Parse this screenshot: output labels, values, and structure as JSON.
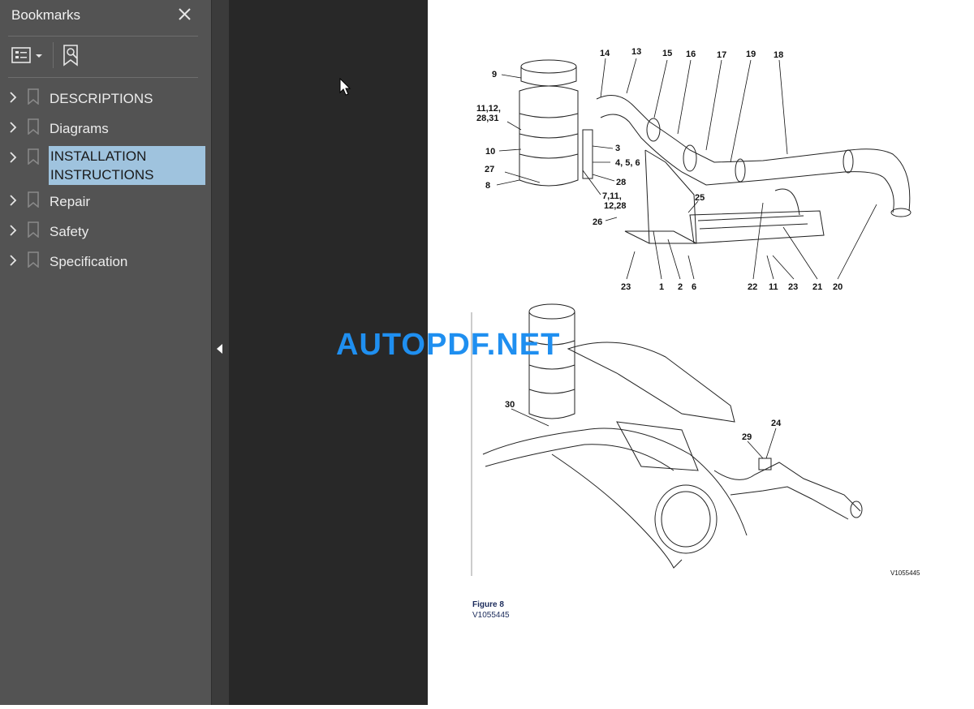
{
  "panel": {
    "title": "Bookmarks",
    "items": [
      {
        "label": "DESCRIPTIONS"
      },
      {
        "label": "Diagrams"
      },
      {
        "label": "INSTALLATION\nINSTRUCTIONS",
        "selected": true
      },
      {
        "label": "Repair"
      },
      {
        "label": "Safety"
      },
      {
        "label": "Specification"
      }
    ]
  },
  "watermark": "AUTOPDF.NET",
  "figure": {
    "caption_title": "Figure 8",
    "caption_id": "V1055445",
    "corner_id": "V1055445",
    "callouts_top": [
      "14",
      "13",
      "15",
      "16",
      "17",
      "19",
      "18",
      "9",
      "11,12,",
      "28,31",
      "10",
      "3",
      "4, 5, 6",
      "27",
      "8",
      "28",
      "7,11,",
      "12,28",
      "25",
      "26",
      "23",
      "1",
      "2",
      "6",
      "22",
      "11",
      "23",
      "21",
      "20"
    ],
    "callouts_bottom": [
      "30",
      "29",
      "24"
    ]
  },
  "colors": {
    "panel_bg": "#535353",
    "selected_bg": "#9fc3de",
    "doc_bg": "#282828",
    "watermark": "#1f8ff0"
  }
}
